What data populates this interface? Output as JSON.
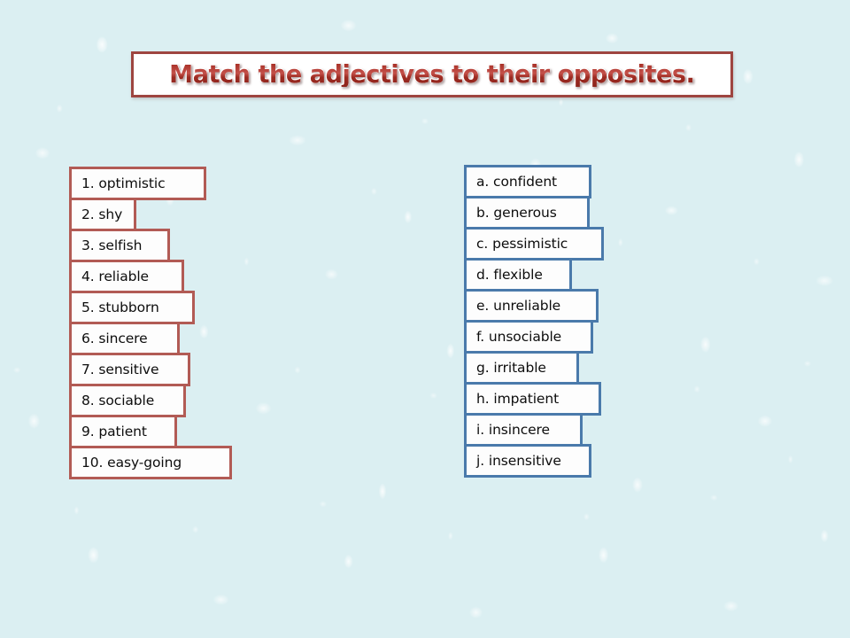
{
  "slide": {
    "background_color": "#dbeff2",
    "background_texture": "water-droplets"
  },
  "title": {
    "text": "Match the adjectives to their opposites.",
    "text_color": "#9e2d24",
    "border_color": "#9e4540",
    "background_color": "#ffffff"
  },
  "left_column": {
    "border_color": "#b25b55",
    "items": [
      {
        "label": "1. optimistic",
        "width": 155
      },
      {
        "label": "2. shy",
        "width": 76
      },
      {
        "label": "3. selfish",
        "width": 114
      },
      {
        "label": "4. reliable",
        "width": 130
      },
      {
        "label": "5. stubborn",
        "width": 142
      },
      {
        "label": "6. sincere",
        "width": 125
      },
      {
        "label": "7. sensitive",
        "width": 137
      },
      {
        "label": "8. sociable",
        "width": 132
      },
      {
        "label": "9. patient",
        "width": 122
      },
      {
        "label": "10. easy-going",
        "width": 184
      }
    ]
  },
  "right_column": {
    "border_color": "#4a7aab",
    "items": [
      {
        "label": "a. confident",
        "width": 144
      },
      {
        "label": "b. generous",
        "width": 142
      },
      {
        "label": "c. pessimistic",
        "width": 158
      },
      {
        "label": "d. flexible",
        "width": 122
      },
      {
        "label": "e. unreliable",
        "width": 152
      },
      {
        "label": "f. unsociable",
        "width": 146
      },
      {
        "label": "g. irritable",
        "width": 130
      },
      {
        "label": "h. impatient",
        "width": 155
      },
      {
        "label": "i. insincere",
        "width": 134
      },
      {
        "label": "j. insensitive",
        "width": 144
      }
    ]
  }
}
